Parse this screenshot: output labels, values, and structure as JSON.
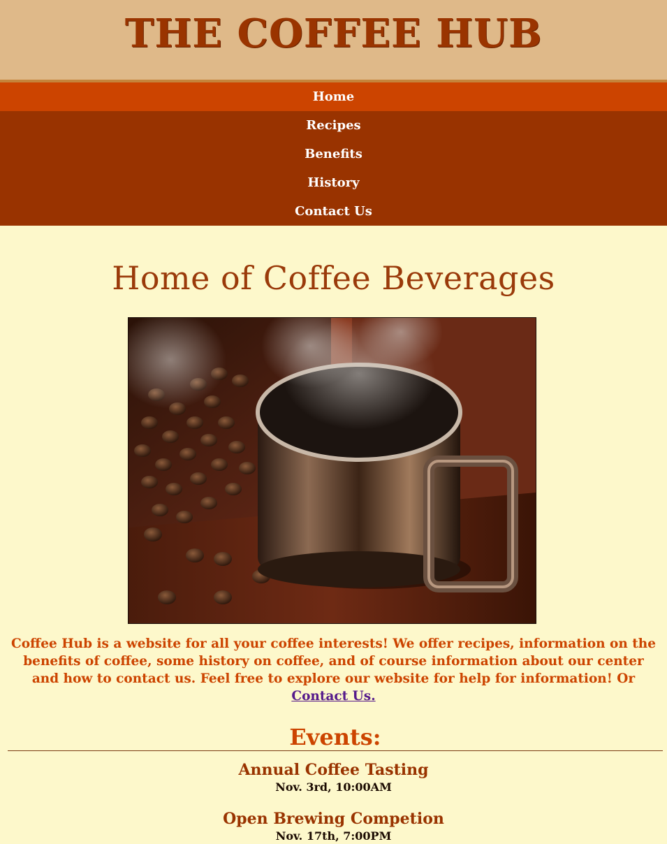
{
  "header": {
    "title": "THE COFFEE HUB"
  },
  "nav": {
    "items": [
      {
        "label": "Home",
        "active": true
      },
      {
        "label": "Recipes",
        "active": false
      },
      {
        "label": "Benefits",
        "active": false
      },
      {
        "label": "History",
        "active": false
      },
      {
        "label": "Contact Us",
        "active": false
      }
    ]
  },
  "main": {
    "heading": "Home of Coffee Beverages",
    "intro_text": "Coffee Hub is a website for all your coffee interests! We offer recipes, information on the benefits of coffee, some history on coffee, and of course information about our center and how to contact us. Feel free to explore our website for help for information! Or ",
    "intro_link": "Contact Us."
  },
  "events": {
    "heading": "Events:",
    "items": [
      {
        "title": "Annual Coffee Tasting",
        "date": "Nov. 3rd, 10:00AM"
      },
      {
        "title": "Open Brewing Competion",
        "date": "Nov. 17th, 7:00PM"
      }
    ]
  },
  "colors": {
    "header_bg": "#dfb989",
    "title": "#9a3400",
    "nav_bg": "#993300",
    "nav_active_bg": "#cc4400",
    "page_bg": "#fdf8cb",
    "text_accent": "#cc4400",
    "link": "#551a8b"
  }
}
